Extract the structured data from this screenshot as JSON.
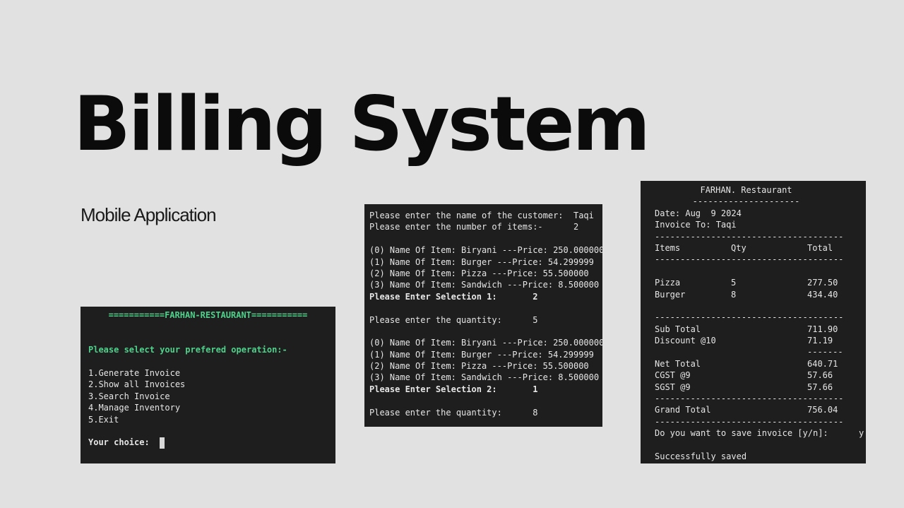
{
  "slide": {
    "title": "Billing System",
    "subtitle": "Mobile Application"
  },
  "menu_terminal": {
    "header": "===========FARHAN-RESTAURANT===========",
    "prompt": "Please select your prefered operation:-",
    "options": [
      "1.Generate Invoice",
      "2.Show all Invoices",
      "3.Search Invoice",
      "4.Manage Inventory",
      "5.Exit"
    ],
    "choice_label": "Your choice:"
  },
  "order_terminal": {
    "customer_prompt": "Please enter the name of the customer:  Taqi",
    "items_prompt": "Please enter the number of items:-      2",
    "catalog": [
      "(0) Name Of Item: Biryani ---Price: 250.000000",
      "(1) Name Of Item: Burger ---Price: 54.299999",
      "(2) Name Of Item: Pizza ---Price: 55.500000",
      "(3) Name Of Item: Sandwich ---Price: 8.500000"
    ],
    "selection_1": "Please Enter Selection 1:       2",
    "quantity_1": "Please enter the quantity:      5",
    "selection_2": "Please Enter Selection 2:       1",
    "quantity_2": "Please enter the quantity:      8"
  },
  "invoice_terminal": {
    "restaurant": "FARHAN. Restaurant",
    "underline": "---------------------",
    "date": "Date: Aug  9 2024",
    "invoice_to": "Invoice To: Taqi",
    "separator": "-------------------------------------",
    "headers": {
      "items": "Items",
      "qty": "Qty",
      "total": "Total"
    },
    "lines": [
      {
        "item": "Pizza",
        "qty": "5",
        "total": "277.50"
      },
      {
        "item": "Burger",
        "qty": "8",
        "total": "434.40"
      }
    ],
    "sub_total_label": "Sub Total",
    "sub_total": "711.90",
    "discount_label": "Discount @10",
    "discount": "71.19",
    "short_rule": "-------",
    "net_total_label": "Net Total",
    "net_total": "640.71",
    "cgst_label": "CGST @9",
    "cgst": "57.66",
    "sgst_label": "SGST @9",
    "sgst": "57.66",
    "grand_total_label": "Grand Total",
    "grand_total": "756.04",
    "save_prompt": "Do you want to save invoice [y/n]:      y",
    "saved_message": "Successfully saved"
  }
}
